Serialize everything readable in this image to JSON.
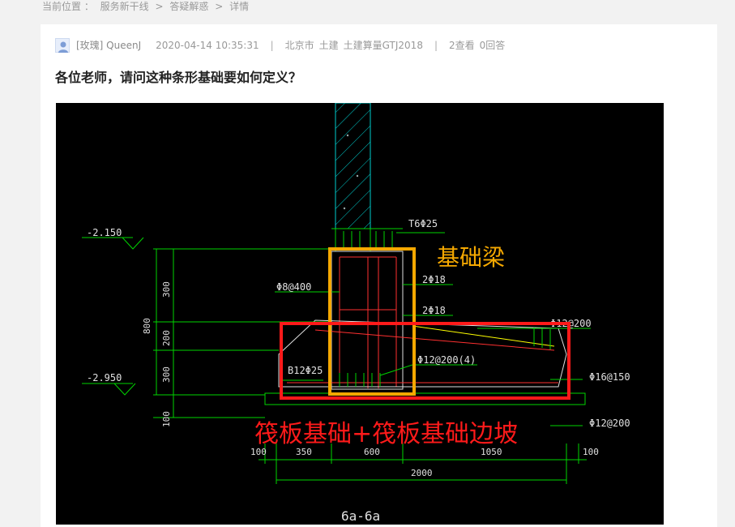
{
  "breadcrumb": {
    "label": "当前位置 ：",
    "items": [
      "服务新干线",
      "答疑解惑",
      "详情"
    ],
    "separator": ">"
  },
  "post": {
    "author": "[玫瑰] QueenJ",
    "datetime": "2020-04-14 10:35:31",
    "region": "北京市",
    "tags": [
      "土建",
      "土建算量GTJ2018"
    ],
    "views": "2查看",
    "answers": "0回答",
    "title": "各位老师，请问这种条形基础要如何定义？"
  },
  "drawing": {
    "labels": {
      "beam_label": "基础梁",
      "raft_label": "筏板基础+筏板基础边坡",
      "section": "6a-6a"
    },
    "elevations": [
      "-2.150",
      "-2.950"
    ],
    "rebar": [
      "T6Φ25",
      "Φ8@400",
      "2Φ18",
      "2Φ18",
      "Φ12@200",
      "Φ12@200(4)",
      "B12Φ25",
      "Φ16@150",
      "Φ12@200"
    ],
    "vertical_dims": [
      "300",
      "200",
      "300",
      "100",
      "800"
    ],
    "horizontal_dims": [
      "100",
      "350",
      "600",
      "1050",
      "100",
      "2000"
    ],
    "colors": {
      "beam_highlight": "#f5a800",
      "raft_highlight": "#ff1a1a",
      "cad_green": "#00d400",
      "cad_cyan": "#00cccc",
      "cad_white": "#e0e0e0"
    }
  }
}
